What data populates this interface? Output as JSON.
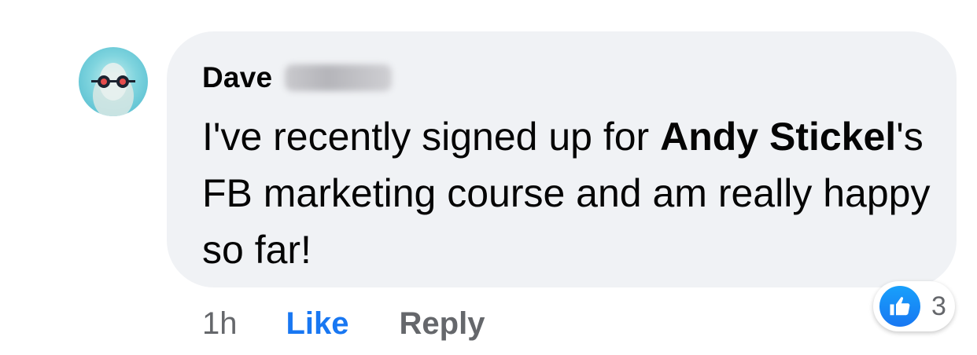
{
  "comment": {
    "author": {
      "first_name": "Dave",
      "last_name_hidden": true
    },
    "text_parts": [
      {
        "text": "I've recently signed up for ",
        "bold": false
      },
      {
        "text": "Andy Stickel",
        "bold": true
      },
      {
        "text": "'s FB marketing course and am really happy so far!",
        "bold": false
      }
    ],
    "timestamp": "1h",
    "actions": {
      "like_label": "Like",
      "reply_label": "Reply"
    },
    "reactions": {
      "icon": "thumbs-up-icon",
      "count": "3"
    }
  },
  "colors": {
    "bubble": "#f0f2f5",
    "like_active": "#1877f2",
    "secondary_text": "#65676b",
    "primary_text": "#050505"
  }
}
